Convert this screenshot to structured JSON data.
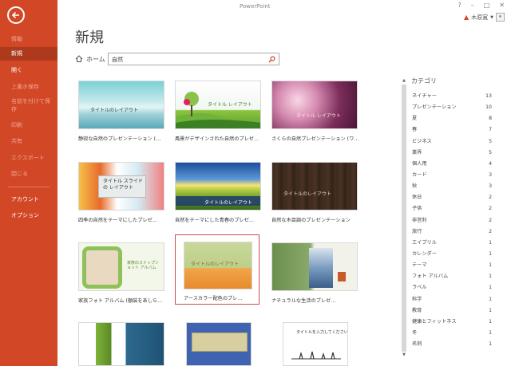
{
  "window": {
    "app_title": "PowerPoint",
    "controls": [
      "?",
      "–",
      "□",
      "✕"
    ],
    "user_name": "木原寛"
  },
  "sidebar": {
    "items": [
      {
        "label": "情報",
        "state": "dim"
      },
      {
        "label": "新規",
        "state": "active"
      },
      {
        "label": "開く",
        "state": "bright"
      },
      {
        "label": "上書き保存",
        "state": "dim"
      },
      {
        "label": "名前を付けて保存",
        "state": "dim"
      },
      {
        "label": "印刷",
        "state": "dim"
      },
      {
        "label": "共有",
        "state": "dim"
      },
      {
        "label": "エクスポート",
        "state": "dim"
      },
      {
        "label": "閉じる",
        "state": "dim"
      },
      {
        "label": "アカウント",
        "state": "bright"
      },
      {
        "label": "オプション",
        "state": "bright"
      }
    ]
  },
  "main": {
    "title": "新規",
    "breadcrumb_home": "ホーム",
    "search_value": "自然"
  },
  "templates": [
    {
      "name": "静寂な自然のプレゼンテーション (…",
      "thumb_text": "タイトルのレイアウト"
    },
    {
      "name": "風景がデザインされた自然のプレゼ…",
      "thumb_text": "タイトル レイアウト"
    },
    {
      "name": "さくらの自然プレゼンテーション (ワ…",
      "thumb_text": "タイトル レイアウト"
    },
    {
      "name": "四季の自然をテーマにしたプレゼ…",
      "thumb_text": "タイトル スライドの レイアウト"
    },
    {
      "name": "自然をテーマにした青春のプレゼ…",
      "thumb_text": "タイトルのレイアウト"
    },
    {
      "name": "自然な木目調のプレゼンテーション",
      "thumb_text": "タイトルのレイアウト"
    },
    {
      "name": "家族フォト アルバム (額装をあしら…",
      "thumb_text": "家族のスナップショット アルバム"
    },
    {
      "name": "アースカラー配色のプレ…",
      "thumb_text": "タイトルのレイアウト"
    },
    {
      "name": "ナチュラルな生活のプレゼ…",
      "thumb_text": ""
    },
    {
      "name": "",
      "thumb_text": ""
    },
    {
      "name": "",
      "thumb_text": ""
    },
    {
      "name": "",
      "thumb_text": "タイトルを入力してください"
    }
  ],
  "categories": {
    "header": "カテゴリ",
    "items": [
      {
        "label": "ネイチャー",
        "count": "13"
      },
      {
        "label": "プレゼンテーション",
        "count": "10"
      },
      {
        "label": "夏",
        "count": "8"
      },
      {
        "label": "春",
        "count": "7"
      },
      {
        "label": "ビジネス",
        "count": "5"
      },
      {
        "label": "業界",
        "count": "5"
      },
      {
        "label": "個人用",
        "count": "4"
      },
      {
        "label": "カード",
        "count": "3"
      },
      {
        "label": "秋",
        "count": "3"
      },
      {
        "label": "休日",
        "count": "2"
      },
      {
        "label": "子供",
        "count": "2"
      },
      {
        "label": "非営利",
        "count": "2"
      },
      {
        "label": "旅行",
        "count": "2"
      },
      {
        "label": "エイプリル",
        "count": "1"
      },
      {
        "label": "カレンダー",
        "count": "1"
      },
      {
        "label": "テーマ",
        "count": "1"
      },
      {
        "label": "フォト アルバム",
        "count": "1"
      },
      {
        "label": "ラベル",
        "count": "1"
      },
      {
        "label": "科学",
        "count": "1"
      },
      {
        "label": "教育",
        "count": "1"
      },
      {
        "label": "健康とフィットネス",
        "count": "1"
      },
      {
        "label": "冬",
        "count": "1"
      },
      {
        "label": "名刺",
        "count": "1"
      }
    ]
  },
  "colors": {
    "sidebar": "#d24726",
    "sidebar_active": "#ae3a1e",
    "selection_border": "#d04a4a"
  },
  "icons": [
    "back-arrow-icon",
    "home-icon",
    "search-icon",
    "warning-icon",
    "user-avatar-icon"
  ]
}
